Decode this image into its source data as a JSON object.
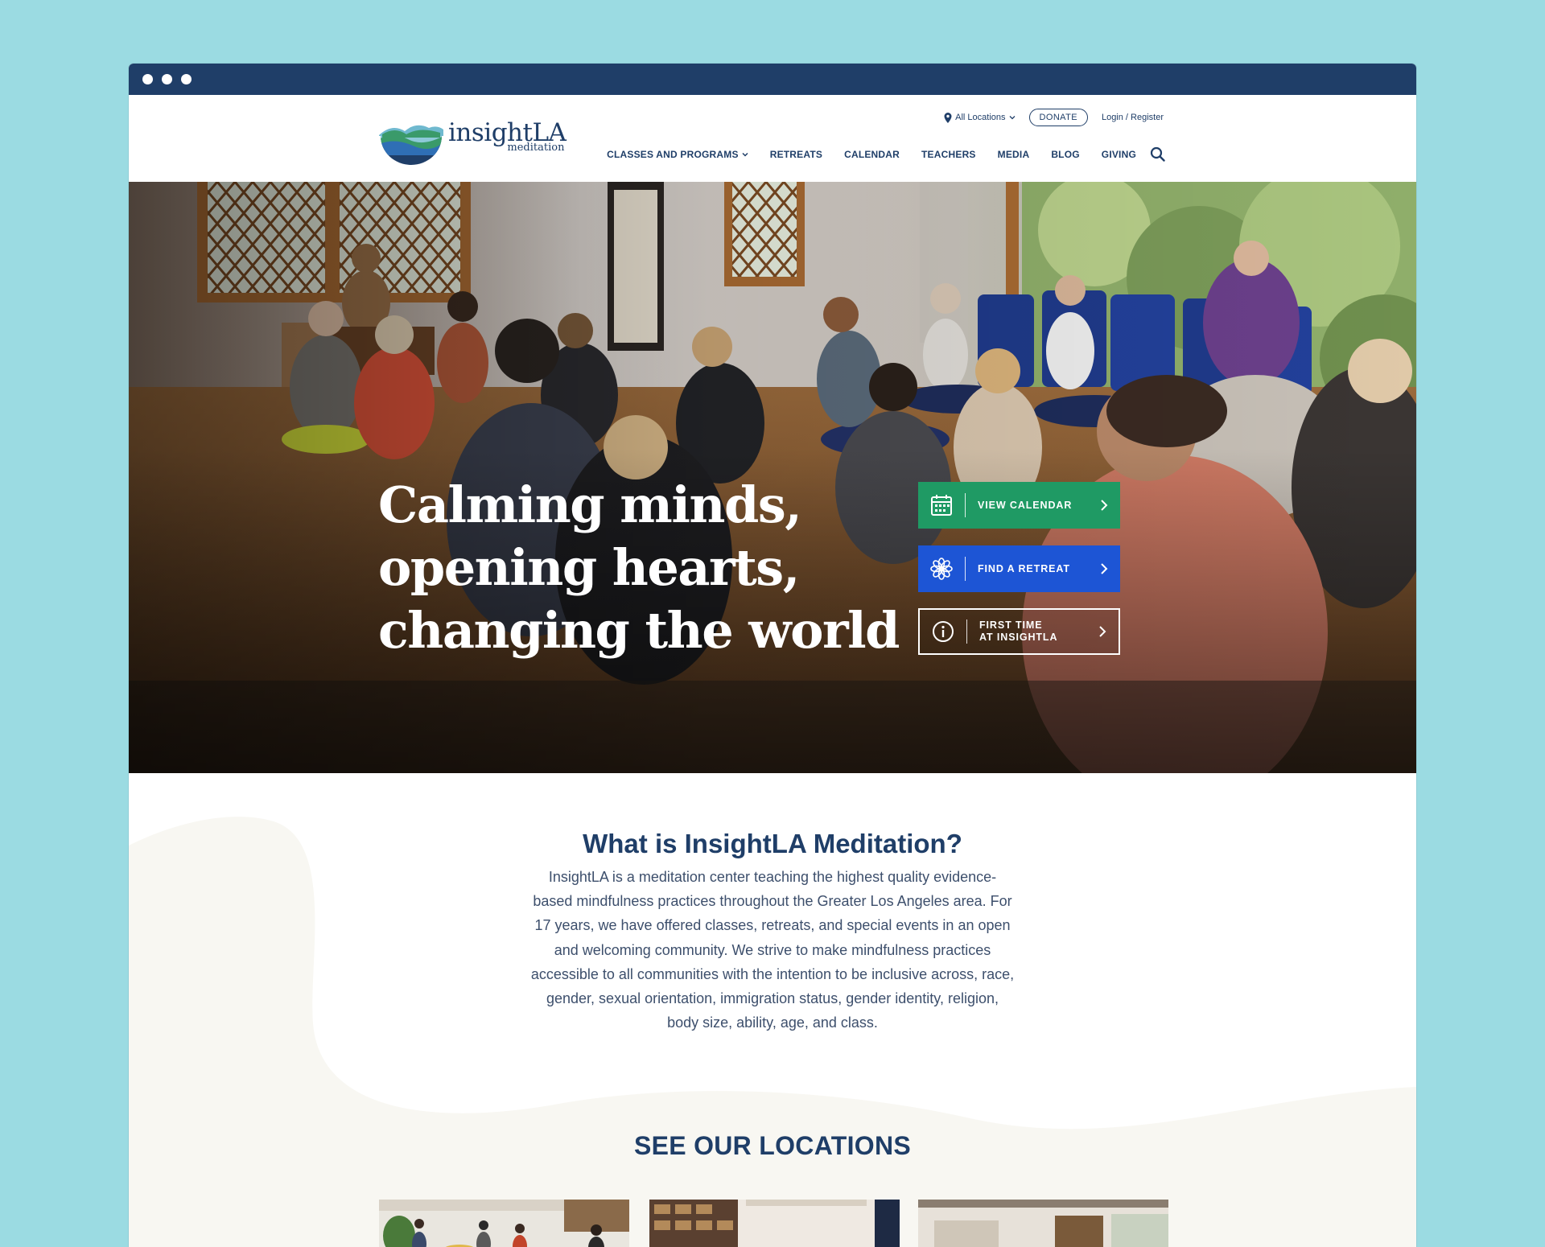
{
  "brand": {
    "name": "insightLA",
    "tagline": "meditation",
    "navy": "#1f3e68",
    "green": "#1f9a64",
    "blue": "#1d55d5",
    "page_background": "#9bdbe2"
  },
  "header": {
    "location_selector": "All Locations",
    "donate_label": "DONATE",
    "login_label": "Login / Register",
    "nav": [
      {
        "label": "CLASSES AND PROGRAMS",
        "has_dropdown": true
      },
      {
        "label": "RETREATS"
      },
      {
        "label": "CALENDAR"
      },
      {
        "label": "TEACHERS"
      },
      {
        "label": "MEDIA"
      },
      {
        "label": "BLOG"
      },
      {
        "label": "GIVING"
      }
    ]
  },
  "hero": {
    "title_lines": [
      "Calming minds,",
      "opening hearts,",
      "changing the world"
    ],
    "ctas": [
      {
        "label": "VIEW CALENDAR",
        "icon": "calendar-icon"
      },
      {
        "label": "FIND A RETREAT",
        "icon": "lotus-icon"
      },
      {
        "label_lines": [
          "FIRST TIME",
          "AT INSIGHTLA"
        ],
        "icon": "info-icon"
      }
    ]
  },
  "about": {
    "title": "What is InsightLA Meditation?",
    "text": "InsightLA is a meditation center teaching the highest quality evidence-based mindfulness practices throughout the Greater Los Angeles area. For 17 years, we have offered classes, retreats, and special events in an open and welcoming community. We strive to make mindfulness practices accessible to all communities with the intention to be inclusive across, race, gender, sexual orientation, immigration status, gender identity, religion, body size, ability, age, and class."
  },
  "locations": {
    "title": "SEE OUR LOCATIONS"
  }
}
